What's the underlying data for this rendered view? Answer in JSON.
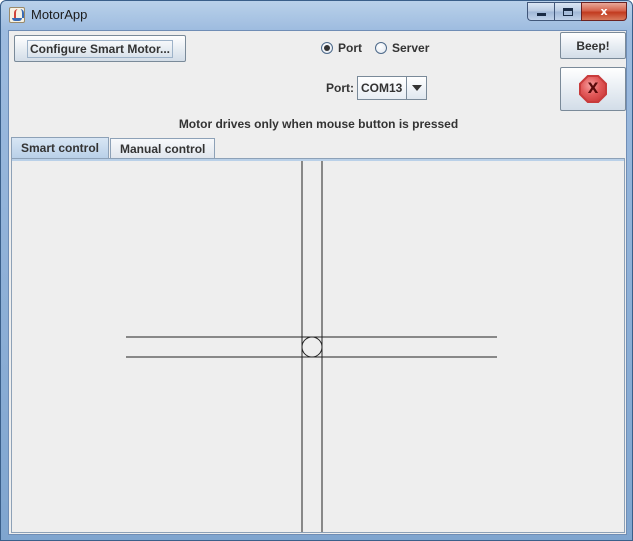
{
  "window": {
    "title": "MotorApp",
    "minimize_glyph": "minimize-icon",
    "maximize_glyph": "maximize-icon",
    "close_label": "x"
  },
  "toolbar": {
    "configure_label": "Configure Smart Motor...",
    "beep_label": "Beep!",
    "stop_icon": "X"
  },
  "connection": {
    "options": [
      {
        "label": "Port",
        "checked": true
      },
      {
        "label": "Server",
        "checked": false
      }
    ],
    "port_label": "Port:",
    "port_value": "COM13"
  },
  "hint": "Motor drives only when mouse button is pressed",
  "tabs": [
    {
      "label": "Smart control",
      "active": true
    },
    {
      "label": "Manual control",
      "active": false
    }
  ],
  "colors": {
    "window_bg": "#eeeeee",
    "accent": "#b9d0e8",
    "stop": "#c83b3b"
  }
}
